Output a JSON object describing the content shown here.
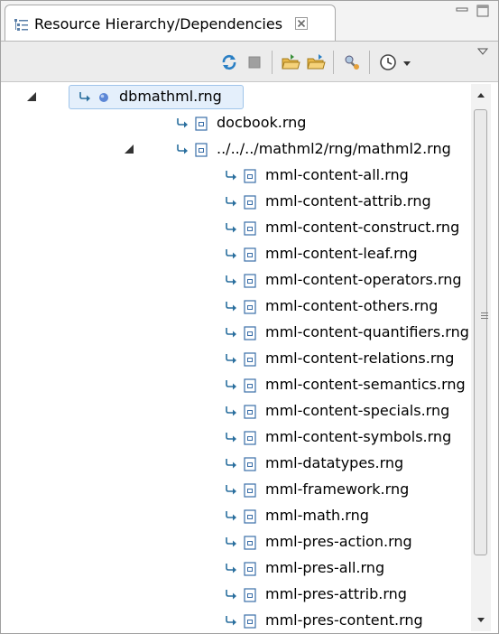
{
  "view": {
    "title": "Resource Hierarchy/Dependencies",
    "colors": {
      "selection": "#e4effb",
      "selection_border": "#9fc4ea",
      "link_arrow": "#2a6f9e",
      "file_icon": "#3a6ea8"
    }
  },
  "toolbar": {
    "buttons": [
      "refresh-icon",
      "stop-icon",
      "open-folder-icon",
      "open-folder-alt-icon",
      "configure-icon",
      "history-icon",
      "dropdown-arrow-icon",
      "view-menu-icon"
    ]
  },
  "tree": {
    "root": {
      "label": "dbmathml.rng",
      "expanded": true,
      "selected": true,
      "icon": "blue-ball-icon"
    },
    "items": [
      {
        "label": "docbook.rng",
        "depth": 1,
        "expanded": null
      },
      {
        "label": "../../../mathml2/rng/mathml2.rng",
        "depth": 1,
        "expanded": true
      },
      {
        "label": "mml-content-all.rng",
        "depth": 2
      },
      {
        "label": "mml-content-attrib.rng",
        "depth": 2
      },
      {
        "label": "mml-content-construct.rng",
        "depth": 2
      },
      {
        "label": "mml-content-leaf.rng",
        "depth": 2
      },
      {
        "label": "mml-content-operators.rng",
        "depth": 2
      },
      {
        "label": "mml-content-others.rng",
        "depth": 2
      },
      {
        "label": "mml-content-quantifiers.rng",
        "depth": 2
      },
      {
        "label": "mml-content-relations.rng",
        "depth": 2
      },
      {
        "label": "mml-content-semantics.rng",
        "depth": 2
      },
      {
        "label": "mml-content-specials.rng",
        "depth": 2
      },
      {
        "label": "mml-content-symbols.rng",
        "depth": 2
      },
      {
        "label": "mml-datatypes.rng",
        "depth": 2
      },
      {
        "label": "mml-framework.rng",
        "depth": 2
      },
      {
        "label": "mml-math.rng",
        "depth": 2
      },
      {
        "label": "mml-pres-action.rng",
        "depth": 2
      },
      {
        "label": "mml-pres-all.rng",
        "depth": 2
      },
      {
        "label": "mml-pres-attrib.rng",
        "depth": 2
      },
      {
        "label": "mml-pres-content.rng",
        "depth": 2
      }
    ]
  }
}
